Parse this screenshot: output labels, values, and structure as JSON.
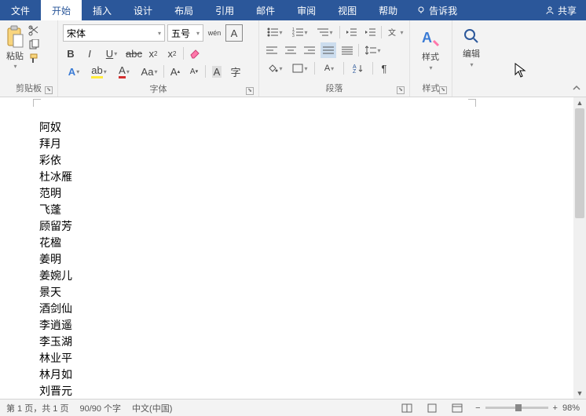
{
  "menu": {
    "file": "文件",
    "home": "开始",
    "insert": "插入",
    "design": "设计",
    "layout": "布局",
    "references": "引用",
    "mailings": "邮件",
    "review": "审阅",
    "view": "视图",
    "help": "帮助",
    "tell_me": "告诉我",
    "share": "共享"
  },
  "ribbon": {
    "clipboard": {
      "label": "剪贴板",
      "paste": "粘贴"
    },
    "font": {
      "label": "字体",
      "name": "宋体",
      "size": "五号",
      "pinyin": "wén",
      "char_border": "A"
    },
    "paragraph": {
      "label": "段落"
    },
    "styles": {
      "label": "样式",
      "button": "样式"
    },
    "editing": {
      "label": "",
      "button": "编辑"
    }
  },
  "document": {
    "lines": [
      "阿奴",
      "拜月",
      "彩依",
      "杜冰雁",
      "范明",
      "飞蓬",
      "顾留芳",
      "花楹",
      "姜明",
      "姜婉儿",
      "景天",
      "酒剑仙",
      "李逍遥",
      "李玉湖",
      "林业平",
      "林月如",
      "刘晋元"
    ]
  },
  "status": {
    "page": "第 1 页，共 1 页",
    "words": "90/90 个字",
    "language": "中文(中国)",
    "zoom": "98%"
  }
}
